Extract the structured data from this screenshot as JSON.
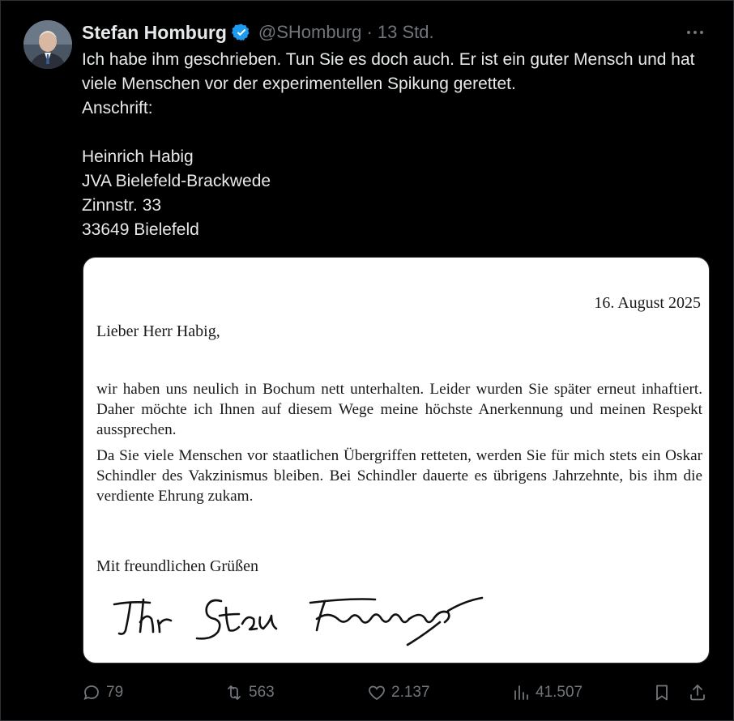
{
  "post": {
    "author_name": "Stefan Homburg",
    "handle_time": "@SHomburg · 13 Std.",
    "text_paragraphs": [
      "Ich habe ihm geschrieben. Tun Sie es doch auch. Er ist ein guter Mensch und hat viele Menschen vor der experimentellen Spikung gerettet.",
      "Anschrift:"
    ],
    "address_lines": [
      "Heinrich Habig",
      "JVA Bielefeld-Brackwede",
      "Zinnstr. 33",
      "33649 Bielefeld"
    ]
  },
  "letter": {
    "date": "16. August 2025",
    "salutation": "Lieber Herr Habig,",
    "paragraphs": [
      "wir haben uns neulich in Bochum nett unterhalten. Leider wurden Sie später erneut inhaftiert. Daher möchte ich Ihnen auf diesem Wege meine höchste Anerkennung und meinen Respekt aussprechen.",
      "Da Sie viele Menschen vor staatlichen Übergriffen retteten, werden Sie für mich stets ein Oskar Schindler des Vakzinismus bleiben. Bei Schindler dauerte es übrigens Jahrzehnte, bis ihm die verdiente Ehrung zukam."
    ],
    "closing": "Mit freundlichen Grüßen",
    "signature": "Ihr Stefan Homburg"
  },
  "actions": {
    "replies": "79",
    "reposts": "563",
    "likes": "2.137",
    "views": "41.507"
  },
  "colors": {
    "background": "#000000",
    "text": "#e7e9ea",
    "muted": "#71767b",
    "verified": "#1d9bf0"
  }
}
